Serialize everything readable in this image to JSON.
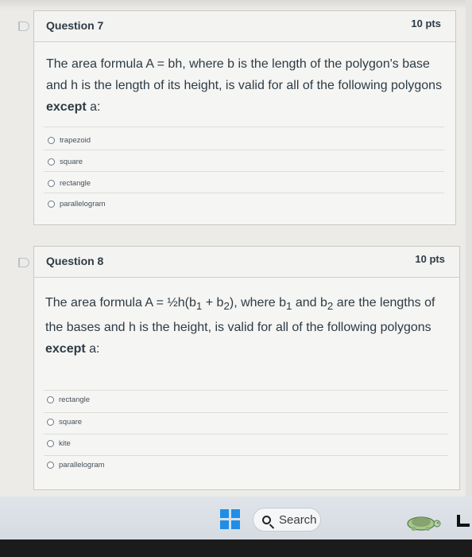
{
  "questions": [
    {
      "title": "Question 7",
      "points": "10 pts",
      "text_before": "The area formula A = bh, where b is the length of the polygon's base and h is the length of its height, is valid for all of the following polygons",
      "emphasis": "except",
      "text_after": "a:",
      "answers": [
        "trapezoid",
        "square",
        "rectangle",
        "parallelogram"
      ]
    },
    {
      "title": "Question 8",
      "points": "10 pts",
      "formula_prefix": "The area formula A = ",
      "fraction": "½",
      "formula_mid": "h(b",
      "sub1": "1",
      "plus": " + b",
      "sub2": "2",
      "formula_suffix": "), where b",
      "sub3": "1",
      "and": " and b",
      "sub4": "2",
      "text_rest": " are the lengths of the bases and h is the height, is valid for all of the following polygons",
      "emphasis": "except",
      "text_after": "a:",
      "answers": [
        "rectangle",
        "square",
        "kite",
        "parallelogram"
      ]
    }
  ],
  "taskbar": {
    "search_label": "Search"
  },
  "icons": {
    "flag": "flag-icon",
    "windows": "windows-start-icon",
    "search": "search-icon",
    "turtle": "turtle-icon"
  }
}
